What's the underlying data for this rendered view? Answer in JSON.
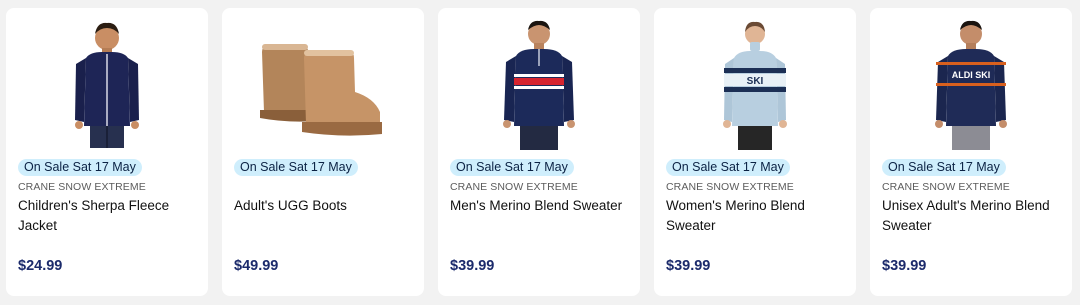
{
  "products": [
    {
      "badge": "On Sale Sat 17 May",
      "brand": "CRANE SNOW EXTREME",
      "title": "Children's Sherpa Fleece Jacket",
      "price": "$24.99",
      "image_icon": "kids-navy-fleece-jacket"
    },
    {
      "badge": "On Sale Sat 17 May",
      "brand": "",
      "title": "Adult's UGG Boots",
      "price": "$49.99",
      "image_icon": "tan-ugg-boots"
    },
    {
      "badge": "On Sale Sat 17 May",
      "brand": "CRANE SNOW EXTREME",
      "title": "Men's Merino Blend Sweater",
      "price": "$39.99",
      "image_icon": "mens-navy-striped-sweater"
    },
    {
      "badge": "On Sale Sat 17 May",
      "brand": "CRANE SNOW EXTREME",
      "title": "Women's Merino Blend Sweater",
      "price": "$39.99",
      "image_icon": "womens-blue-ski-sweater"
    },
    {
      "badge": "On Sale Sat 17 May",
      "brand": "CRANE SNOW EXTREME",
      "title": "Unisex Adult's Merino Blend Sweater",
      "price": "$39.99",
      "image_icon": "unisex-aldi-ski-sweater"
    }
  ],
  "image_text": {
    "women_sweater": "SKI",
    "unisex_sweater": "ALDI SKI"
  },
  "colors": {
    "badge_bg": "#cfeefc",
    "price": "#1b2a6b",
    "page_bg": "#f2f2f2",
    "card_bg": "#ffffff"
  }
}
